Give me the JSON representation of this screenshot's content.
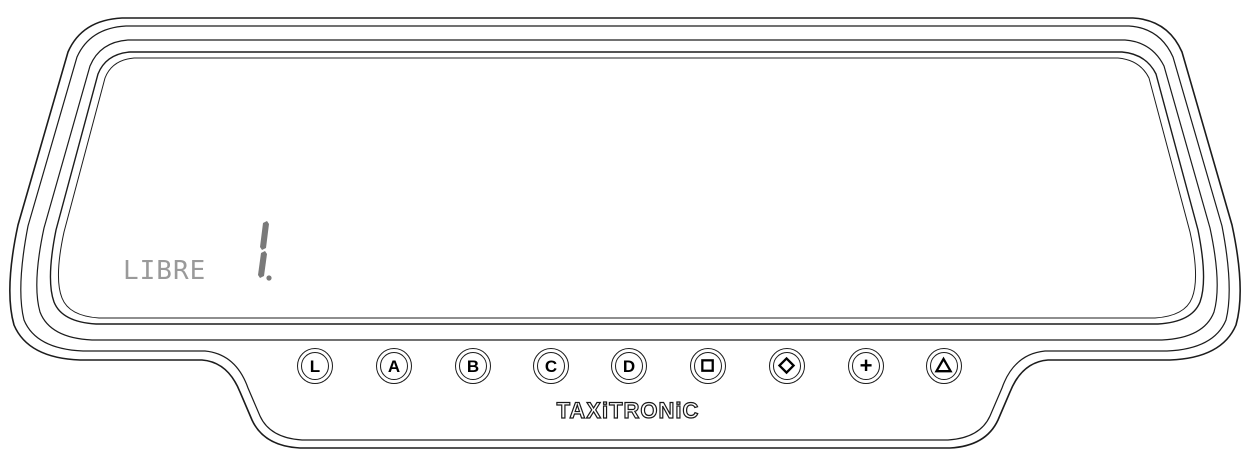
{
  "display": {
    "status": "LIBRE",
    "digit": "1."
  },
  "buttons": [
    {
      "label": "L"
    },
    {
      "label": "A"
    },
    {
      "label": "B"
    },
    {
      "label": "C"
    },
    {
      "label": "D"
    },
    {
      "icon": "square-icon"
    },
    {
      "icon": "diamond-icon"
    },
    {
      "label": "+"
    },
    {
      "icon": "triangle-icon"
    }
  ],
  "brand": "TAXiTRONiC",
  "colors": {
    "outline": "#1c1c1c",
    "segment": "#7a7a7a",
    "status_text": "#9a9a9a"
  }
}
